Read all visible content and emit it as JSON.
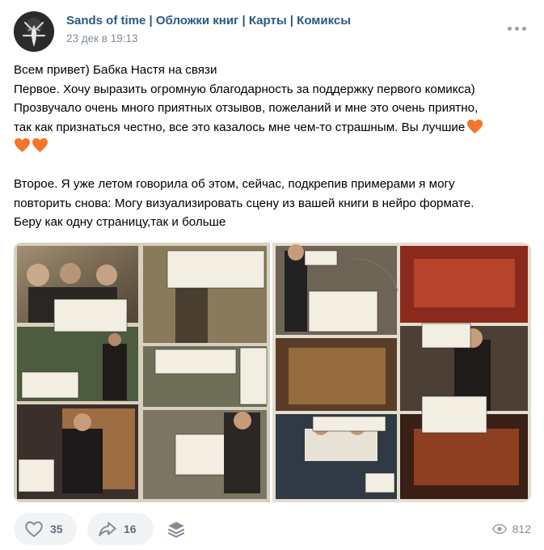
{
  "post": {
    "author": "Sands of time | Обложки книг | Карты | Комиксы",
    "date": "23 дек в 19:13",
    "lines": [
      "Всем привет) Бабка Настя на связи",
      "Первое. Хочу выразить огромную благодарность за поддержку первого комикса)",
      "Прозвучало очень много приятных отзывов, пожеланий и мне это очень приятно,",
      "так как признаться честно, все это казалось мне чем-то страшным. Вы лучшие",
      "",
      "",
      "Второе. Я уже летом говорила об этом, сейчас, подкрепив примерами я могу",
      "повторить снова: Могу визуализировать сцену из вашей книги в нейро формате.",
      "Беру как одну страницу,так и больше"
    ]
  },
  "footer": {
    "likes": "35",
    "shares": "16",
    "views": "812"
  },
  "icons": {
    "more": "more-horizontal-icon",
    "like": "heart-icon",
    "share": "share-arrow-icon",
    "repost": "stack-icon",
    "views": "eye-icon",
    "emoji": "orange-heart-emoji"
  },
  "colors": {
    "author": "#2a5885",
    "muted": "#818c99",
    "button_bg": "#f2f3f5",
    "heart_emoji": "#f4762b"
  }
}
